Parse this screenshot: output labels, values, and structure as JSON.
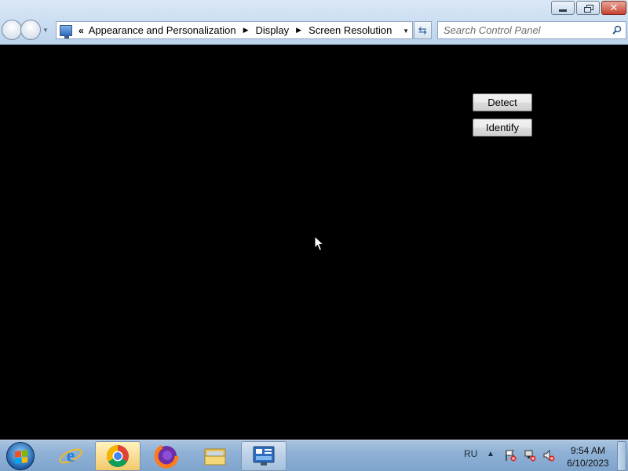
{
  "window": {
    "controls": {
      "minimize_icon": "minimize-icon",
      "restore_icon": "restore-icon",
      "close_icon": "close-icon"
    }
  },
  "address_bar": {
    "overflow_chevron": "«",
    "breadcrumbs": [
      "Appearance and Personalization",
      "Display",
      "Screen Resolution"
    ]
  },
  "search": {
    "placeholder": "Search Control Panel"
  },
  "content": {
    "background": "#000000",
    "detect_label": "Detect",
    "identify_label": "Identify"
  },
  "taskbar": {
    "apps": [
      "Internet Explorer",
      "Google Chrome",
      "Mozilla Firefox",
      "Windows Explorer",
      "Control Panel"
    ],
    "language": "RU",
    "time": "9:54 AM",
    "date": "6/10/2023"
  }
}
